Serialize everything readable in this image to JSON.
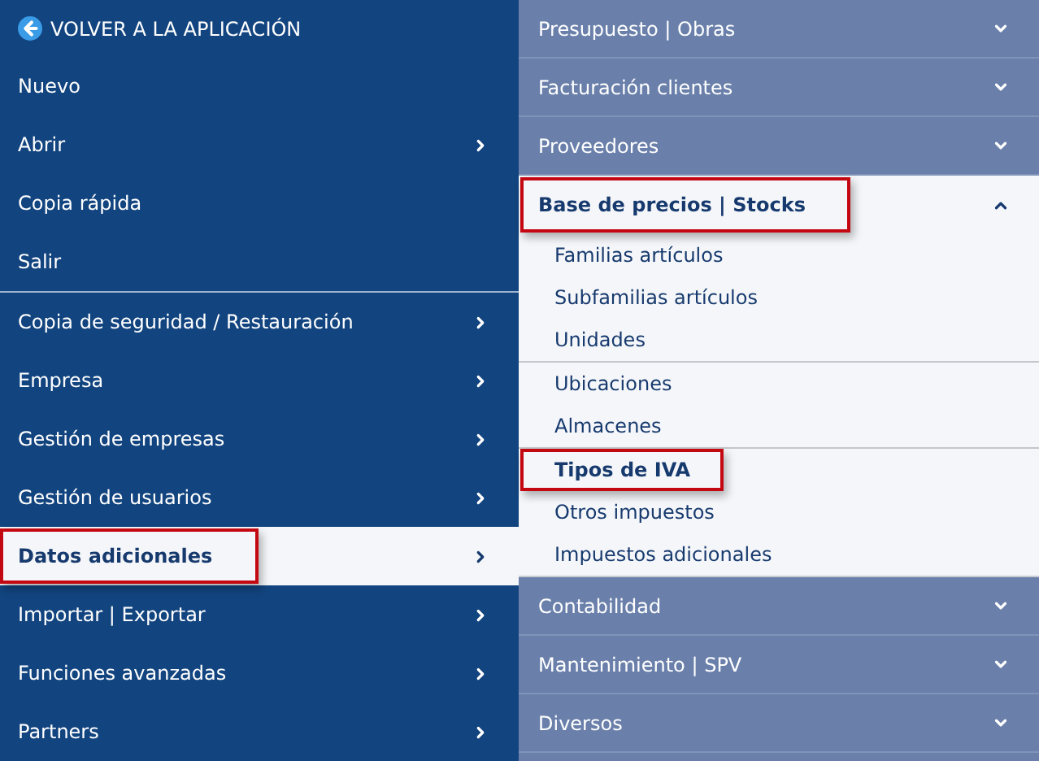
{
  "left_menu": {
    "back": {
      "label": "VOLVER A LA APLICACIÓN"
    },
    "groups": [
      [
        {
          "label": "Nuevo",
          "has_submenu": false,
          "selected": false,
          "highlighted": false
        },
        {
          "label": "Abrir",
          "has_submenu": true,
          "selected": false,
          "highlighted": false
        },
        {
          "label": "Copia rápida",
          "has_submenu": false,
          "selected": false,
          "highlighted": false
        },
        {
          "label": "Salir",
          "has_submenu": false,
          "selected": false,
          "highlighted": false
        }
      ],
      [
        {
          "label": "Copia de seguridad / Restauración",
          "has_submenu": true,
          "selected": false,
          "highlighted": false
        },
        {
          "label": "Empresa",
          "has_submenu": true,
          "selected": false,
          "highlighted": false
        },
        {
          "label": "Gestión de empresas",
          "has_submenu": true,
          "selected": false,
          "highlighted": false
        },
        {
          "label": "Gestión de usuarios",
          "has_submenu": true,
          "selected": false,
          "highlighted": false
        },
        {
          "label": "Datos adicionales",
          "has_submenu": true,
          "selected": true,
          "highlighted": true
        },
        {
          "label": "Importar | Exportar",
          "has_submenu": true,
          "selected": false,
          "highlighted": false
        },
        {
          "label": "Funciones avanzadas",
          "has_submenu": true,
          "selected": false,
          "highlighted": false
        },
        {
          "label": "Partners",
          "has_submenu": true,
          "selected": false,
          "highlighted": false
        }
      ]
    ]
  },
  "submenu": {
    "sections": [
      {
        "label": "Presupuesto | Obras",
        "expanded": false,
        "highlighted": false
      },
      {
        "label": "Facturación clientes",
        "expanded": false,
        "highlighted": false
      },
      {
        "label": "Proveedores",
        "expanded": false,
        "highlighted": false
      },
      {
        "label": "Base de precios | Stocks",
        "expanded": true,
        "highlighted": true,
        "groups": [
          [
            {
              "label": "Familias artículos",
              "selected": false,
              "highlighted": false
            },
            {
              "label": "Subfamilias artículos",
              "selected": false,
              "highlighted": false
            },
            {
              "label": "Unidades",
              "selected": false,
              "highlighted": false
            }
          ],
          [
            {
              "label": "Ubicaciones",
              "selected": false,
              "highlighted": false
            },
            {
              "label": "Almacenes",
              "selected": false,
              "highlighted": false
            }
          ],
          [
            {
              "label": "Tipos de IVA",
              "selected": true,
              "highlighted": true
            },
            {
              "label": "Otros impuestos",
              "selected": false,
              "highlighted": false
            },
            {
              "label": "Impuestos adicionales",
              "selected": false,
              "highlighted": false
            }
          ]
        ]
      },
      {
        "label": "Contabilidad",
        "expanded": false,
        "highlighted": false
      },
      {
        "label": "Mantenimiento | SPV",
        "expanded": false,
        "highlighted": false
      },
      {
        "label": "Diversos",
        "expanded": false,
        "highlighted": false
      }
    ]
  }
}
